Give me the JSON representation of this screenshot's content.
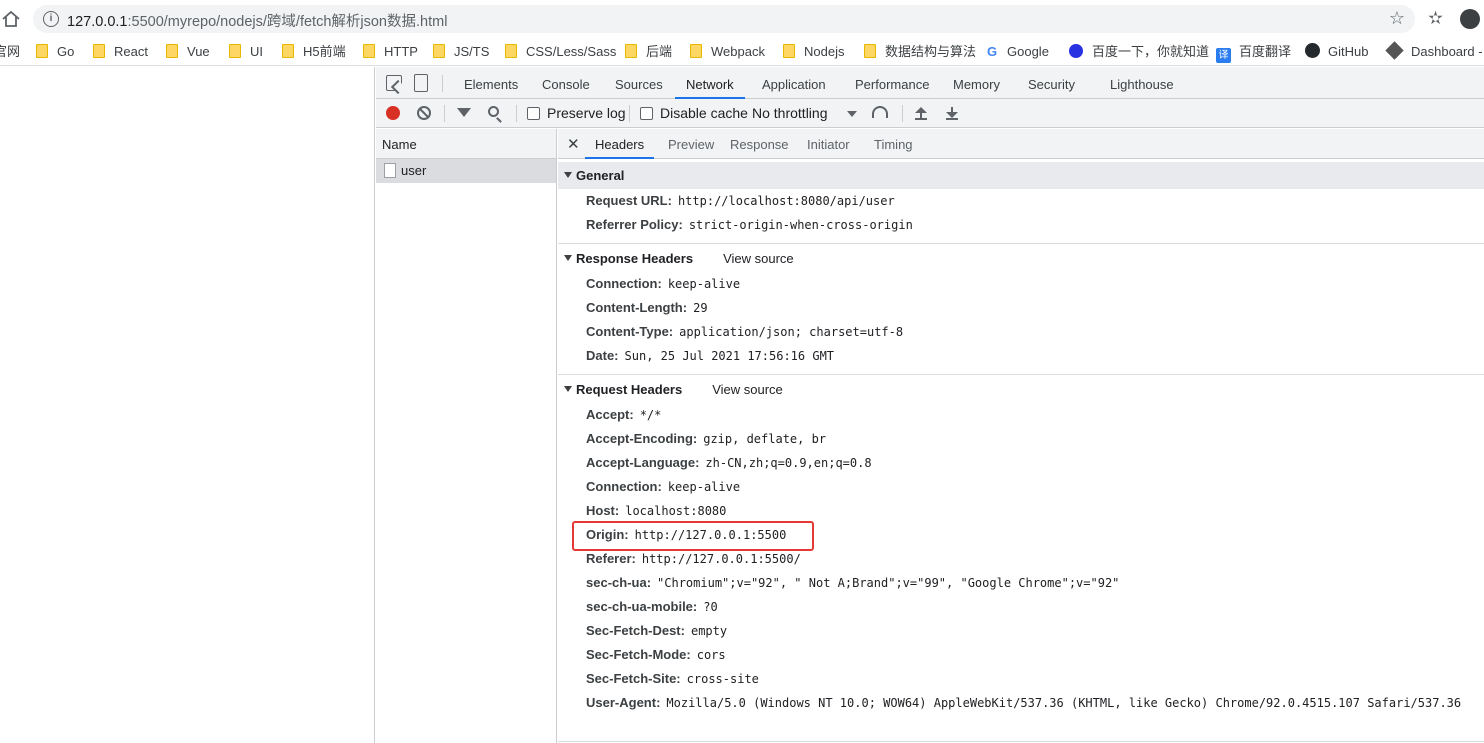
{
  "browser": {
    "url_host": "127.0.0.1",
    "url_path": ":5500/myrepo/nodejs/跨域/fetch解析json数据.html"
  },
  "bookmarks": [
    {
      "label": "官网",
      "icon": "none"
    },
    {
      "label": "Go",
      "icon": "folder-icon"
    },
    {
      "label": "React",
      "icon": "folder-icon"
    },
    {
      "label": "Vue",
      "icon": "folder-icon"
    },
    {
      "label": "UI",
      "icon": "folder-icon"
    },
    {
      "label": "H5前端",
      "icon": "folder-icon"
    },
    {
      "label": "HTTP",
      "icon": "folder-icon"
    },
    {
      "label": "JS/TS",
      "icon": "folder-icon"
    },
    {
      "label": "CSS/Less/Sass",
      "icon": "folder-icon"
    },
    {
      "label": "后端",
      "icon": "folder-icon"
    },
    {
      "label": "Webpack",
      "icon": "folder-icon"
    },
    {
      "label": "Nodejs",
      "icon": "folder-icon"
    },
    {
      "label": "数据结构与算法",
      "icon": "folder-icon"
    },
    {
      "label": "Google",
      "icon": "google-icon"
    },
    {
      "label": "百度一下，你就知道",
      "icon": "baidu-icon"
    },
    {
      "label": "百度翻译",
      "icon": "baidu-translate-icon"
    },
    {
      "label": "GitHub",
      "icon": "github-icon"
    },
    {
      "label": "Dashboard -",
      "icon": "dashboard-icon"
    }
  ],
  "devtools": {
    "tabs": [
      "Elements",
      "Console",
      "Sources",
      "Network",
      "Application",
      "Performance",
      "Memory",
      "Security",
      "Lighthouse"
    ],
    "active_tab": "Network",
    "toolbar": {
      "preserve_log": "Preserve log",
      "disable_cache": "Disable cache",
      "throttling": "No throttling"
    },
    "name_header": "Name",
    "request_name": "user",
    "detail_tabs": [
      "Headers",
      "Preview",
      "Response",
      "Initiator",
      "Timing"
    ],
    "active_detail_tab": "Headers",
    "view_source": "View source",
    "general": {
      "title": "General",
      "rows": [
        {
          "key": "Request URL:",
          "value": "http://localhost:8080/api/user"
        },
        {
          "key": "Referrer Policy:",
          "value": "strict-origin-when-cross-origin"
        }
      ]
    },
    "response_headers": {
      "title": "Response Headers",
      "rows": [
        {
          "key": "Connection:",
          "value": "keep-alive"
        },
        {
          "key": "Content-Length:",
          "value": "29"
        },
        {
          "key": "Content-Type:",
          "value": "application/json; charset=utf-8"
        },
        {
          "key": "Date:",
          "value": "Sun, 25 Jul 2021 17:56:16 GMT"
        }
      ]
    },
    "request_headers": {
      "title": "Request Headers",
      "rows": [
        {
          "key": "Accept:",
          "value": "*/*"
        },
        {
          "key": "Accept-Encoding:",
          "value": "gzip, deflate, br"
        },
        {
          "key": "Accept-Language:",
          "value": "zh-CN,zh;q=0.9,en;q=0.8"
        },
        {
          "key": "Connection:",
          "value": "keep-alive"
        },
        {
          "key": "Host:",
          "value": "localhost:8080"
        },
        {
          "key": "Origin:",
          "value": "http://127.0.0.1:5500"
        },
        {
          "key": "Referer:",
          "value": "http://127.0.0.1:5500/"
        },
        {
          "key": "sec-ch-ua:",
          "value": "\"Chromium\";v=\"92\", \" Not A;Brand\";v=\"99\", \"Google Chrome\";v=\"92\""
        },
        {
          "key": "sec-ch-ua-mobile:",
          "value": "?0"
        },
        {
          "key": "Sec-Fetch-Dest:",
          "value": "empty"
        },
        {
          "key": "Sec-Fetch-Mode:",
          "value": "cors"
        },
        {
          "key": "Sec-Fetch-Site:",
          "value": "cross-site"
        },
        {
          "key": "User-Agent:",
          "value": "Mozilla/5.0 (Windows NT 10.0; WOW64) AppleWebKit/537.36 (KHTML, like Gecko) Chrome/92.0.4515.107 Safari/537.36"
        }
      ]
    }
  },
  "colors": {
    "accent": "#1a73e8",
    "record": "#d93025",
    "highlight": "#e53935"
  }
}
